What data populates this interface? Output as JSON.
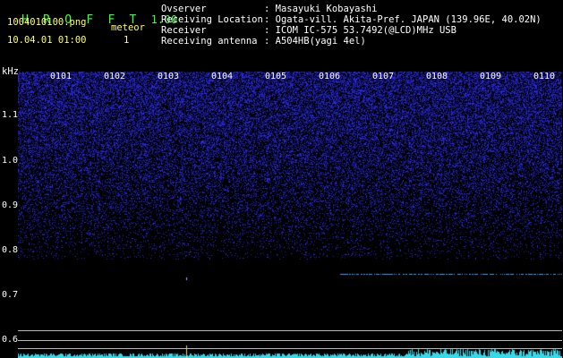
{
  "app": {
    "name_letters": [
      "H",
      "R",
      "O",
      "F",
      "F",
      "T"
    ],
    "version": "1.00"
  },
  "file": {
    "filename": "1004010100.png",
    "datetime": "10.04.01 01:00",
    "meteor_label": "meteor",
    "meteor_count": "1"
  },
  "info": {
    "rows": [
      {
        "label": "Ovserver",
        "value": ": Masayuki Kobayashi"
      },
      {
        "label": "Receiving Location",
        "value": ": Ogata-vill. Akita-Pref. JAPAN (139.96E, 40.02N)"
      },
      {
        "label": "Receiver",
        "value": ": ICOM IC-575 53.7492(@LCD)MHz USB"
      },
      {
        "label": "Receiving antenna",
        "value": ": A504HB(yagi 4el)"
      }
    ]
  },
  "spectrogram": {
    "y_unit": "kHz",
    "y_ticks": [
      "1.1",
      "1.0",
      "0.9",
      "0.8",
      "0.7",
      "0.6"
    ],
    "time_ticks": [
      "0101",
      "0102",
      "0103",
      "0104",
      "0105",
      "0106",
      "0107",
      "0108",
      "0109",
      "0110"
    ],
    "colors": {
      "noise": "#2b2bff",
      "trace": "#5fd0ff",
      "label": "#ffffff",
      "grid": "#b7b7b7"
    }
  }
}
